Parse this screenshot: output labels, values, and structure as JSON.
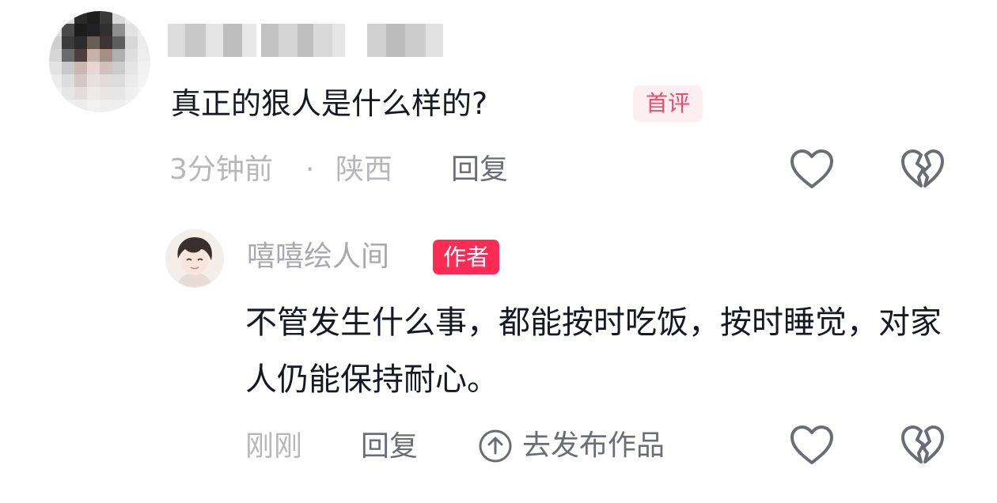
{
  "comment": {
    "text": "真正的狠人是什么样的?",
    "badge": "首评",
    "time": "3分钟前",
    "separator": "·",
    "location": "陕西",
    "reply_label": "回复",
    "like_icon": "heart-outline-icon",
    "dislike_icon": "broken-heart-icon"
  },
  "reply": {
    "author_name": "嘻嘻绘人间",
    "author_badge": "作者",
    "text": "不管发生什么事，都能按时吃饭，按时睡觉，对家人仍能保持耐心。",
    "time": "刚刚",
    "reply_label": "回复",
    "publish_label": "去发布作品",
    "publish_icon": "arrow-up-circle-icon",
    "like_icon": "heart-outline-icon",
    "dislike_icon": "broken-heart-icon"
  },
  "colors": {
    "accent": "#fe2c55",
    "first_badge_bg": "#fdeef1",
    "first_badge_text": "#f2496e",
    "meta_gray": "#b6b6bb",
    "icon_gray": "#6b6d75"
  }
}
